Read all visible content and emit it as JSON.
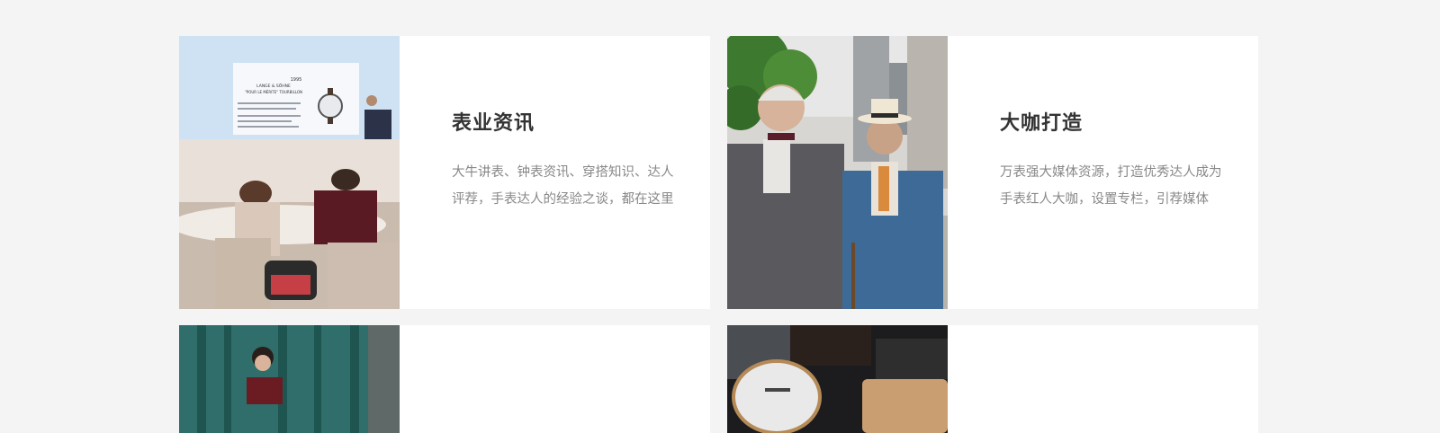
{
  "cards": [
    {
      "title": "表业资讯",
      "description": "大牛讲表、钟表资讯、穿搭知识、达人评荐，手表达人的经验之谈，都在这里",
      "image": "watch-seminar-photo",
      "slide_text": {
        "year": "1995",
        "line1": "LANGE & SÖHNE",
        "line2": "\"POUR LE MÉRITE\" TOURBILLON"
      }
    },
    {
      "title": "大咖打造",
      "description": "万表强大媒体资源，打造优秀达人成为手表红人大咖，设置专栏，引荐媒体",
      "image": "gentlemen-street-photo"
    },
    {
      "title": "",
      "description": "",
      "image": "woman-street-photo"
    },
    {
      "title": "",
      "description": "",
      "image": "watch-closeup-photo"
    }
  ],
  "colors": {
    "page_background": "#f4f4f4",
    "card_background": "#ffffff",
    "title": "#333333",
    "description": "#888888"
  }
}
